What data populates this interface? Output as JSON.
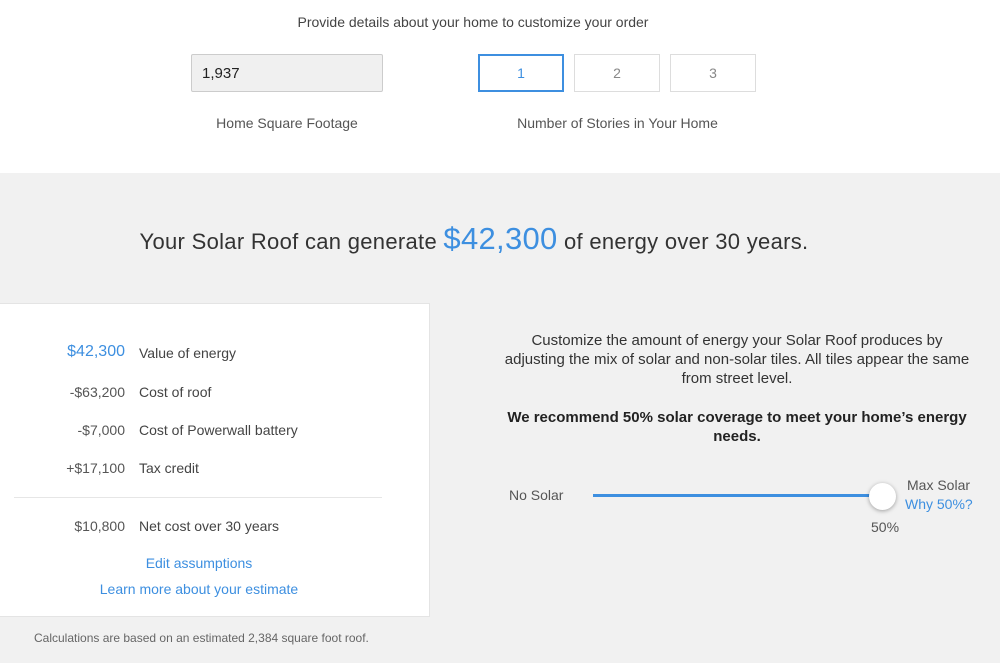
{
  "details": {
    "intro": "Provide details about your home to customize your order",
    "square_footage": {
      "value": "1,937",
      "label": "Home Square Footage"
    },
    "stories": {
      "options": [
        "1",
        "2",
        "3"
      ],
      "selected": "1",
      "label": "Number of Stories in Your Home"
    }
  },
  "headline": {
    "prefix": "Your Solar Roof can generate",
    "amount": "$42,300",
    "suffix": "of energy over 30 years."
  },
  "summary": {
    "rows": [
      {
        "value": "$42,300",
        "label": "Value of energy"
      },
      {
        "value": "-$63,200",
        "label": "Cost of roof"
      },
      {
        "value": "-$7,000",
        "label": "Cost of Powerwall battery"
      },
      {
        "value": "+$17,100",
        "label": "Tax credit"
      }
    ],
    "net": {
      "value": "$10,800",
      "label": "Net cost over 30 years"
    },
    "edit_link": "Edit assumptions",
    "learn_link": "Learn more about your estimate"
  },
  "footnote": "Calculations are based on an estimated 2,384 square foot roof.",
  "customize": {
    "text": "Customize the amount of energy your Solar Roof produces by adjusting the mix of solar and non-solar tiles. All tiles appear the same from street level.",
    "recommendation": "We recommend 50% solar coverage to meet your home’s energy needs.",
    "slider": {
      "min_label": "No Solar",
      "max_label": "Max Solar",
      "why_link": "Why 50%?",
      "value_label": "50%",
      "value": 50
    }
  },
  "colors": {
    "accent": "#3d8fe0",
    "background": "#f1f1f1"
  }
}
